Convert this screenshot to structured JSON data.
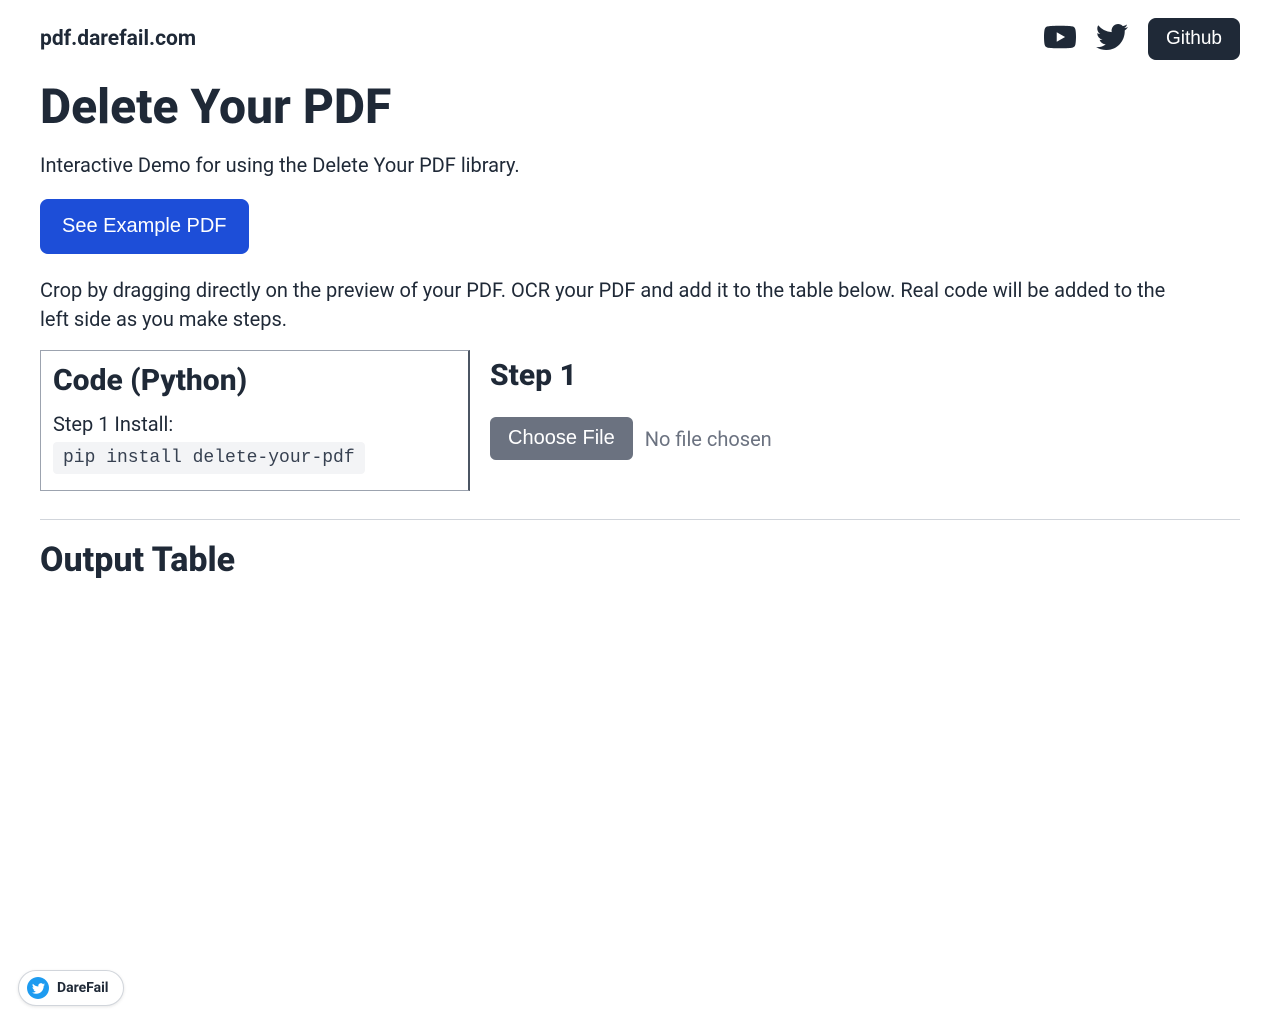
{
  "header": {
    "site_name": "pdf.darefail.com",
    "github_label": "Github"
  },
  "main": {
    "title": "Delete Your PDF",
    "subtitle": "Interactive Demo for using the Delete Your PDF library.",
    "see_example_label": "See Example PDF",
    "instructions": "Crop by dragging directly on the preview of your PDF. OCR your PDF and add it to the table below. Real code will be added to the left side as you make steps."
  },
  "code_panel": {
    "heading": "Code (Python)",
    "install_label": "Step 1 Install:",
    "install_command": "pip install delete-your-pdf"
  },
  "step_panel": {
    "heading": "Step 1",
    "choose_file_label": "Choose File",
    "no_file_text": "No file chosen"
  },
  "output": {
    "heading": "Output Table"
  },
  "badge": {
    "text": "DareFail"
  }
}
